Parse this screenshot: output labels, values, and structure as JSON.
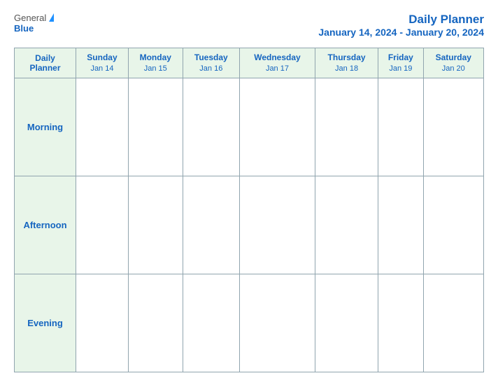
{
  "header": {
    "logo_general": "General",
    "logo_blue": "Blue",
    "main_title": "Daily Planner",
    "date_range": "January 14, 2024 - January 20, 2024"
  },
  "columns": [
    {
      "day": "Daily\nPlanner",
      "date": ""
    },
    {
      "day": "Sunday",
      "date": "Jan 14"
    },
    {
      "day": "Monday",
      "date": "Jan 15"
    },
    {
      "day": "Tuesday",
      "date": "Jan 16"
    },
    {
      "day": "Wednesday",
      "date": "Jan 17"
    },
    {
      "day": "Thursday",
      "date": "Jan 18"
    },
    {
      "day": "Friday",
      "date": "Jan 19"
    },
    {
      "day": "Saturday",
      "date": "Jan 20"
    }
  ],
  "rows": [
    {
      "label": "Morning"
    },
    {
      "label": "Afternoon"
    },
    {
      "label": "Evening"
    }
  ]
}
